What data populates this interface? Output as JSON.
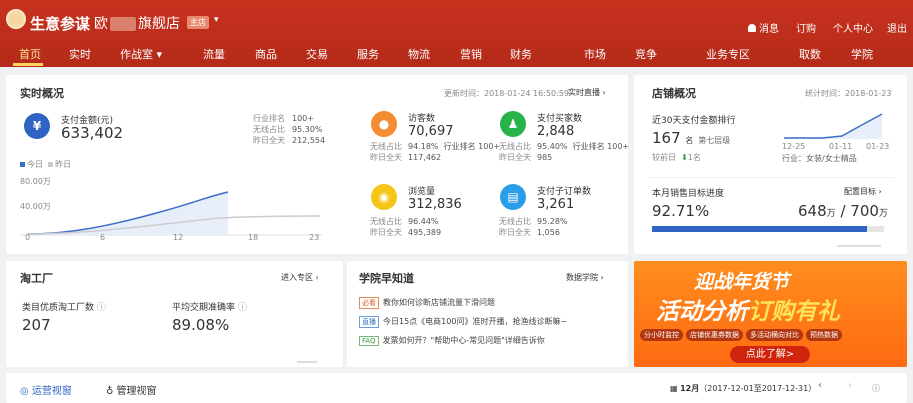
{
  "header": {
    "brand": "生意参谋",
    "shop_prefix": "欧",
    "shop_suffix": "旗舰店",
    "shop_tag": "主店",
    "links": [
      "消息",
      "订购",
      "个人中心",
      "退出"
    ]
  },
  "nav": {
    "items": [
      "首页",
      "实时",
      "作战室",
      "流量",
      "商品",
      "交易",
      "服务",
      "物流",
      "营销",
      "财务",
      "市场",
      "竞争",
      "业务专区",
      "取数",
      "学院"
    ],
    "active": "首页"
  },
  "realtime": {
    "title": "实时概况",
    "updated": "更新时间：2018-01-24 16:50:59",
    "live_link": "实时直播",
    "pay": {
      "icon": "¥",
      "label": "支付金额(元)",
      "value": "633,402",
      "rank_label": "行业排名",
      "rank": "100+",
      "wireless_label": "无线占比",
      "wireless": "95.30%",
      "yday_label": "昨日全天",
      "yday": "212,554"
    },
    "legend": [
      "今日",
      "昨日"
    ],
    "chart": {
      "y_labels": [
        "80.00万",
        "40.00万"
      ],
      "x_labels": [
        "0",
        "6",
        "12",
        "18",
        "23"
      ],
      "today_color": "#3a6fc9",
      "yday_color": "#cccccc"
    },
    "metrics": [
      {
        "label": "访客数",
        "value": "70,697",
        "icon_color": "#f58b32",
        "icon": "paw-icon",
        "wireless": "94.18%",
        "rank": "100+",
        "yday": "117,462"
      },
      {
        "label": "支付买家数",
        "value": "2,848",
        "icon_color": "#27b24a",
        "icon": "users-icon",
        "wireless": "95.40%",
        "rank": "100+",
        "yday": "985"
      },
      {
        "label": "浏览量",
        "value": "312,836",
        "icon_color": "#f5c518",
        "icon": "eye-icon",
        "wireless": "96.44%",
        "rank": "",
        "yday": "495,389"
      },
      {
        "label": "支付子订单数",
        "value": "3,261",
        "icon_color": "#2b9de8",
        "icon": "order-icon",
        "wireless": "95.28%",
        "rank": "",
        "yday": "1,056"
      }
    ],
    "wireless_label": "无线占比",
    "rank_label": "行业排名",
    "yday_label": "昨日全天"
  },
  "store": {
    "title": "店铺概况",
    "stat_time": "统计时间：2018-01-23",
    "rank_label": "近30天支付金额排行",
    "rank_value": "167",
    "rank_unit": "名",
    "level": "第七层级",
    "compare": "较前日",
    "compare_val": "1名",
    "industry": "行业：女装/女士精品",
    "dates": [
      "12-25",
      "01-11",
      "01-23"
    ],
    "target_label": "本月销售目标进度",
    "target_link": "配置目标",
    "progress_pct": "92.71%",
    "progress": 0.9271,
    "amount": "648",
    "amount_unit": "万",
    "sep": "/",
    "target": "700",
    "target_unit": "万"
  },
  "taogong": {
    "title": "淘工厂",
    "link": "进入专区",
    "m1_label": "类目优质淘工厂数",
    "m1_value": "207",
    "m2_label": "平均交期准确率",
    "m2_value": "89.08%"
  },
  "academy": {
    "title": "学院早知道",
    "link": "数据学院",
    "items": [
      {
        "tag": "必看",
        "text": "教你如何诊断店铺流量下滑问题"
      },
      {
        "tag": "直播",
        "text": "今日15点《电商100问》准时开播，抢渔线诊断嘛~"
      },
      {
        "tag": "FAQ",
        "text": "发票如何开？\"帮助中心-常见问题\"详细告诉你"
      }
    ]
  },
  "banner": {
    "line1": "迎战年货节",
    "line2a": "活动分析",
    "line2b": "订购有礼",
    "chips": [
      "分小时监控",
      "店铺优惠券数据",
      "多活动横向对比",
      "预热数据"
    ],
    "button": "点此了解>"
  },
  "bottom": {
    "tab1": "运营视窗",
    "tab2": "管理视窗",
    "month": "12月",
    "range": "（2017-12-01至2017-12-31）"
  }
}
